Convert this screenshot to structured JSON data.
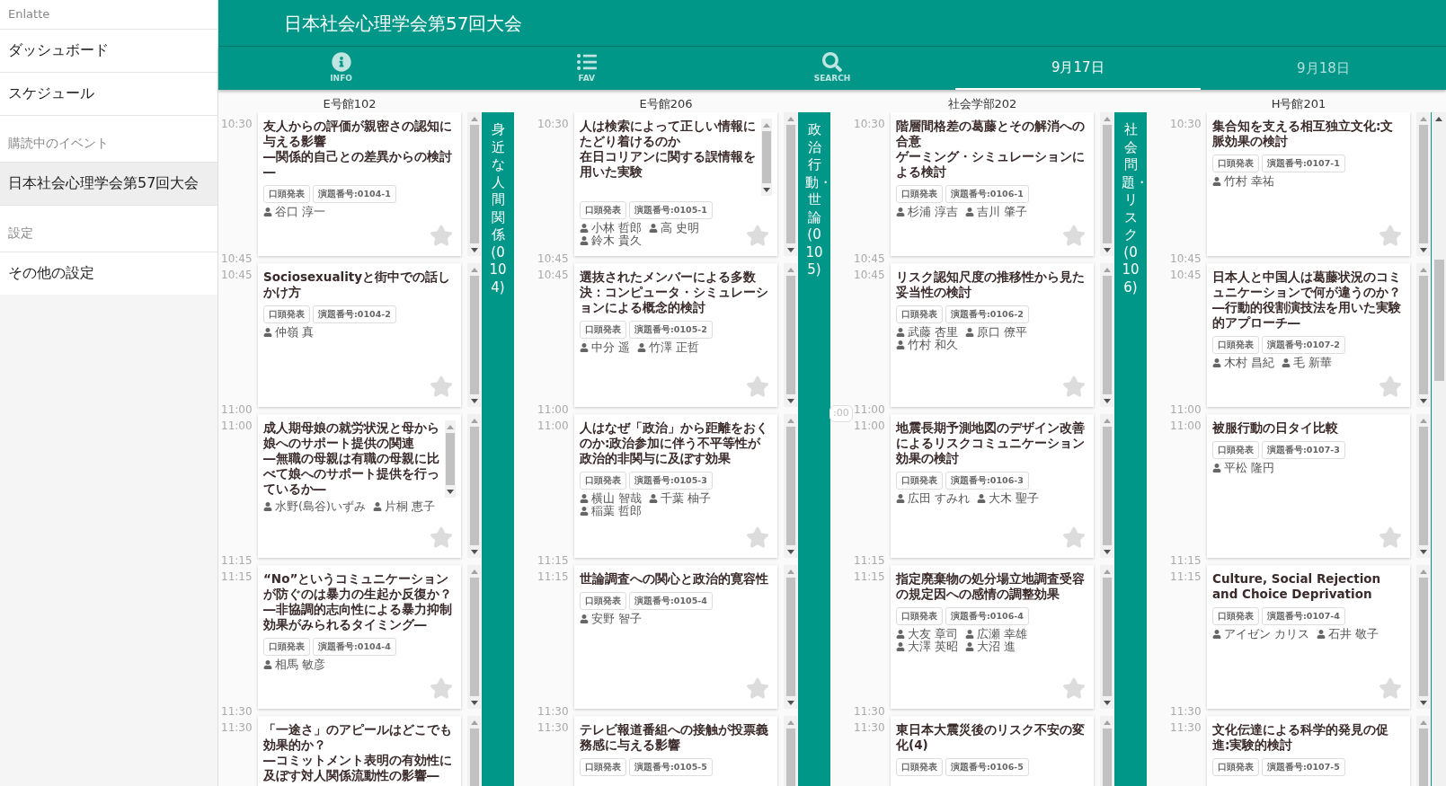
{
  "sidebar": {
    "brand": "Enlatte",
    "items": [
      {
        "kind": "item",
        "label": "ダッシュボード",
        "selected": false
      },
      {
        "kind": "item",
        "label": "スケジュール",
        "selected": false
      },
      {
        "kind": "section",
        "label": "購読中のイベント"
      },
      {
        "kind": "item",
        "label": "日本社会心理学会第57回大会",
        "selected": true
      },
      {
        "kind": "section",
        "label": "設定"
      },
      {
        "kind": "item",
        "label": "その他の設定",
        "selected": false
      }
    ]
  },
  "header": {
    "title": "日本社会心理学会第57回大会"
  },
  "tabs": [
    {
      "kind": "icon",
      "label": "INFO",
      "selected": false
    },
    {
      "kind": "icon",
      "label": "FAV",
      "selected": false
    },
    {
      "kind": "icon",
      "label": "SEARCH",
      "selected": false
    },
    {
      "kind": "date",
      "label": "9月17日",
      "selected": true
    },
    {
      "kind": "date",
      "label": "9月18日",
      "selected": false
    }
  ],
  "rooms": [
    {
      "name": "E号館102",
      "session": "身近な人間関係(0104)",
      "slots": [
        {
          "start": "10:30",
          "end": "10:45",
          "title": [
            "友人からの評価が親密さの認知に与える影響",
            "―関係的自己との差異からの検討―"
          ],
          "tags": [
            "口頭発表",
            "演題番号:0104-1"
          ],
          "authors": [
            "谷口 淳一"
          ],
          "favorite": false
        },
        {
          "start": "10:45",
          "end": "11:00",
          "title": "Sociosexualityと街中での話しかけ方",
          "tags": [
            "口頭発表",
            "演題番号:0104-2"
          ],
          "authors": [
            "仲嶺 真"
          ],
          "favorite": false
        },
        {
          "start": "11:00",
          "end": "11:15",
          "title": [
            "成人期母娘の就労状況と母から娘へのサポート提供の関連",
            "―無職の母親は有職の母親に比べて娘へのサポート提供を行っているか―"
          ],
          "title_scrollbar": true,
          "authors": [
            "水野(島谷)いずみ",
            "片桐 恵子"
          ],
          "favorite": false
        },
        {
          "start": "11:15",
          "end": "11:30",
          "title": [
            "“No”というコミュニケーションが防ぐのは暴力の生起か反復か？",
            "―非協調的志向性による暴力抑制効果がみられるタイミング―"
          ],
          "tags": [
            "口頭発表",
            "演題番号:0104-4"
          ],
          "authors": [
            "相馬 敏彦"
          ],
          "favorite": false
        },
        {
          "start": "11:30",
          "title": [
            "「一途さ」のアピールはどこでも効果的か？",
            "―コミットメント表明の有効性に及ぼす対人関係流動性の影響―"
          ]
        }
      ]
    },
    {
      "name": "E号館206",
      "session": "政治行動・世論(0105)",
      "slots": [
        {
          "start": "10:30",
          "end": "10:45",
          "title": [
            "人は検索によって正しい情報にたどり着けるのか",
            "在日コリアンに関する誤情報を用いた実験"
          ],
          "title_scrollbar": true,
          "tags": [
            "口頭発表",
            "演題番号:0105-1"
          ],
          "authors": [
            "小林 哲郎",
            "高 史明",
            "鈴木 貴久"
          ],
          "favorite": false
        },
        {
          "start": "10:45",
          "end": "11:00",
          "title": "選抜されたメンバーによる多数決：コンピュータ・シミュレーションによる概念的検討",
          "tags": [
            "口頭発表",
            "演題番号:0105-2"
          ],
          "authors": [
            "中分 遥",
            "竹澤 正哲"
          ],
          "favorite": false
        },
        {
          "start": "11:00",
          "end": "11:15",
          "title": "人はなぜ「政治」から距離をおくのか:政治参加に伴う不平等性が政治的非関与に及ぼす効果",
          "tags": [
            "口頭発表",
            "演題番号:0105-3"
          ],
          "authors": [
            "横山 智哉",
            "千葉 柚子",
            "稲葉 哲郎"
          ],
          "favorite": false
        },
        {
          "start": "11:15",
          "end": "11:30",
          "title": "世論調査への関心と政治的寛容性",
          "tags": [
            "口頭発表",
            "演題番号:0105-4"
          ],
          "authors": [
            "安野 智子"
          ],
          "favorite": false
        },
        {
          "start": "11:30",
          "title": "テレビ報道番組への接触が投票義務感に与える影響",
          "tags": [
            "口頭発表",
            "演題番号:0105-5"
          ]
        }
      ]
    },
    {
      "name": "社会学部202",
      "session": "社会問題・リスク(0106)",
      "marker": ":00",
      "slots": [
        {
          "start": "10:30",
          "end": "10:45",
          "title": [
            "階層間格差の葛藤とその解消への合意",
            "ゲーミング・シミュレーションによる検討"
          ],
          "tags": [
            "口頭発表",
            "演題番号:0106-1"
          ],
          "authors": [
            "杉浦 淳吉",
            "吉川 肇子"
          ],
          "favorite": false
        },
        {
          "start": "10:45",
          "end": "11:00",
          "title": "リスク認知尺度の推移性から見た妥当性の検討",
          "tags": [
            "口頭発表",
            "演題番号:0106-2"
          ],
          "authors": [
            "武藤 杏里",
            "原口 僚平",
            "竹村 和久"
          ],
          "favorite": false
        },
        {
          "start": "11:00",
          "end": "11:15",
          "title": "地震長期予測地図のデザイン改善によるリスクコミュニケーション効果の検討",
          "tags": [
            "口頭発表",
            "演題番号:0106-3"
          ],
          "authors": [
            "広田 すみれ",
            "大木 聖子"
          ],
          "favorite": false
        },
        {
          "start": "11:15",
          "end": "11:30",
          "title": "指定廃棄物の処分場立地調査受容の規定因への感情の調整効果",
          "tags": [
            "口頭発表",
            "演題番号:0106-4"
          ],
          "authors": [
            "大友 章司",
            "広瀬 幸雄",
            "大澤 英昭",
            "大沼 進"
          ],
          "favorite": false
        },
        {
          "start": "11:30",
          "title": "東日本大震災後のリスク不安の変化(4)",
          "tags": [
            "口頭発表",
            "演題番号:0106-5"
          ]
        }
      ]
    },
    {
      "name": "H号館201",
      "slots": [
        {
          "start": "10:30",
          "end": "10:45",
          "title": "集合知を支える相互独立文化:文脈効果の検討",
          "tags": [
            "口頭発表",
            "演題番号:0107-1"
          ],
          "authors": [
            "竹村 幸祐"
          ],
          "favorite": false
        },
        {
          "start": "10:45",
          "end": "11:00",
          "title": [
            "日本人と中国人は葛藤状況のコミュニケーションで何が違うのか？",
            "―行動的役割演技法を用いた実験的アプローチ―"
          ],
          "tags": [
            "口頭発表",
            "演題番号:0107-2"
          ],
          "authors": [
            "木村 昌紀",
            "毛 新華"
          ],
          "favorite": false
        },
        {
          "start": "11:00",
          "end": "11:15",
          "title": "被服行動の日タイ比較",
          "tags": [
            "口頭発表",
            "演題番号:0107-3"
          ],
          "authors": [
            "平松 隆円"
          ],
          "favorite": false
        },
        {
          "start": "11:15",
          "end": "11:30",
          "title": "Culture, Social Rejection and Choice Deprivation",
          "tags": [
            "口頭発表",
            "演題番号:0107-4"
          ],
          "authors": [
            "アイゼン カリス",
            "石井 敬子"
          ],
          "favorite": false
        },
        {
          "start": "11:30",
          "title": "文化伝達による科学的発見の促進:実験的検討",
          "tags": [
            "口頭発表",
            "演題番号:0107-5"
          ]
        }
      ]
    }
  ]
}
